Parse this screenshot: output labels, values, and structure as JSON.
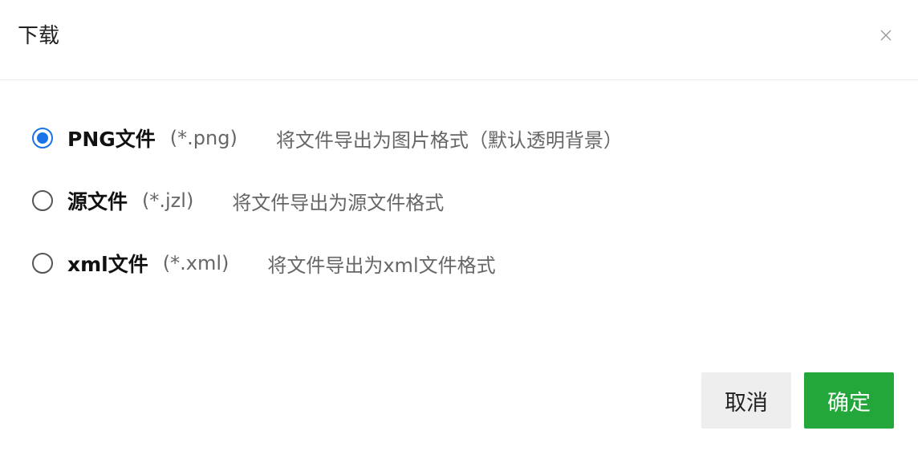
{
  "dialog": {
    "title": "下载",
    "close_icon": "close-icon"
  },
  "options": [
    {
      "name": "PNG文件",
      "ext": "(*.png)",
      "desc": "将文件导出为图片格式（默认透明背景）",
      "selected": true
    },
    {
      "name": "源文件",
      "ext": "(*.jzl)",
      "desc": "将文件导出为源文件格式",
      "selected": false
    },
    {
      "name": "xml文件",
      "ext": "(*.xml)",
      "desc": "将文件导出为xml文件格式",
      "selected": false
    }
  ],
  "buttons": {
    "cancel_label": "取消",
    "ok_label": "确定"
  },
  "colors": {
    "accent": "#1a73e8",
    "confirm": "#23a63a",
    "cancel_bg": "#eeeeee"
  }
}
